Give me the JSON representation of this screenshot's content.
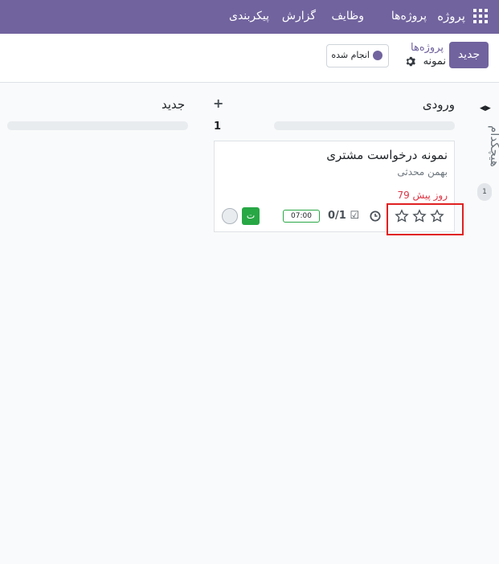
{
  "navbar": {
    "brand": "پروژه",
    "menu": [
      "پروژه‌ها",
      "وظایف",
      "گزارش",
      "پیکربندی"
    ]
  },
  "control_panel": {
    "new_button": "جدید",
    "breadcrumb_parent": "پروژه‌ها",
    "breadcrumb_current": "نمونه",
    "done_filter": "انجام شده"
  },
  "folded_column": {
    "title": "هیچکدام",
    "count": "1"
  },
  "columns": [
    {
      "title": "ورودی",
      "count": "1",
      "cards": [
        {
          "title": "نمونه درخواست مشتری",
          "customer": "بهمن محدثی",
          "date": "79 روز پیش",
          "checklist": "0/1",
          "time": "07:00",
          "tag_letter": "ت",
          "priority_stars": 3
        }
      ]
    },
    {
      "title": "جدید"
    }
  ],
  "colors": {
    "brand": "#71639e",
    "overdue": "#dc3545",
    "tag": "#28a745",
    "highlight": "#e02020"
  }
}
